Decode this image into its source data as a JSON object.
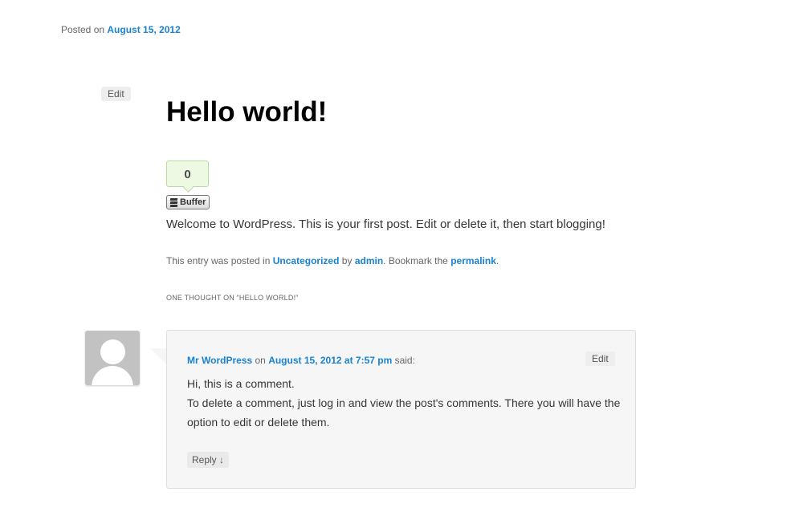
{
  "post": {
    "posted_prefix": "Posted on",
    "posted_date": "August 15, 2012",
    "edit_label": "Edit",
    "title": "Hello world!",
    "buffer": {
      "count": "0",
      "label": "Buffer"
    },
    "content": "Welcome to WordPress. This is your first post. Edit or delete it, then start blogging!",
    "meta": {
      "prefix": "This entry was posted in",
      "category": "Uncategorized",
      "by": "by",
      "author": "admin",
      "bookmark": ". Bookmark the",
      "permalink": "permalink",
      "end": "."
    }
  },
  "comments": {
    "title": "ONE THOUGHT ON “HELLO WORLD!”",
    "items": [
      {
        "author": "Mr WordPress",
        "on": "on",
        "date": "August 15, 2012 at 7:57 pm",
        "said": "said:",
        "edit_label": "Edit",
        "lines": [
          "Hi, this is a comment.",
          "To delete a comment, just log in and view the post's comments. There you will have the option to edit or delete them."
        ],
        "reply_label": "Reply ↓"
      }
    ]
  }
}
